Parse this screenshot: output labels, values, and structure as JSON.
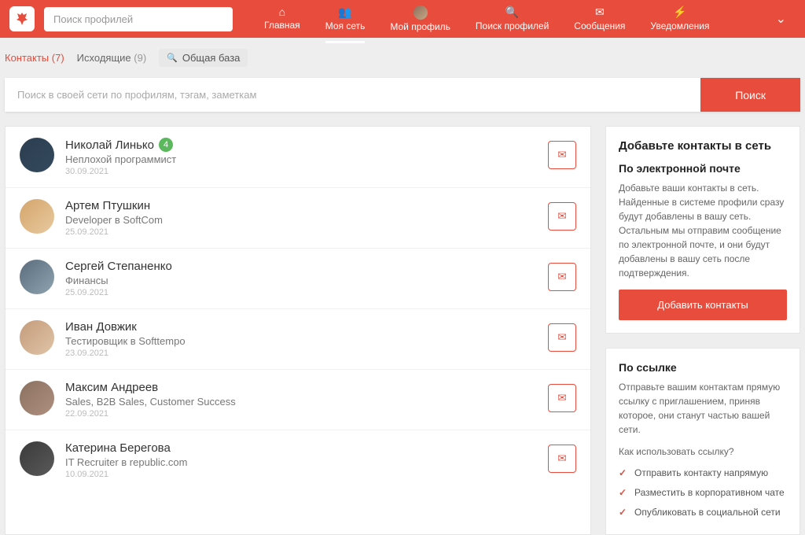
{
  "topbar": {
    "search_placeholder": "Поиск профилей",
    "nav": [
      {
        "label": "Главная"
      },
      {
        "label": "Моя сеть"
      },
      {
        "label": "Мой профиль"
      },
      {
        "label": "Поиск профилей"
      },
      {
        "label": "Сообщения"
      },
      {
        "label": "Уведомления"
      }
    ]
  },
  "tabs": {
    "contacts_label": "Контакты",
    "contacts_count": "(7)",
    "outgoing_label": "Исходящие",
    "outgoing_count": "(9)",
    "global_label": "Общая база"
  },
  "search": {
    "placeholder": "Поиск в своей сети по профилям, тэгам, заметкам",
    "button": "Поиск"
  },
  "contacts": [
    {
      "name": "Николай Линько",
      "badge": "4",
      "title": "Неплохой программист",
      "date": "30.09.2021"
    },
    {
      "name": "Артем Птушкин",
      "title": "Developer в SoftCom",
      "date": "25.09.2021"
    },
    {
      "name": "Сергей Степаненко",
      "title": "Финансы",
      "date": "25.09.2021"
    },
    {
      "name": "Иван Довжик",
      "title": "Тестировщик в Softtempo",
      "date": "23.09.2021"
    },
    {
      "name": "Максим Андреев",
      "title": "Sales, B2B Sales, Customer Success",
      "date": "22.09.2021"
    },
    {
      "name": "Катерина Берегова",
      "title": "IT Recruiter в republic.com",
      "date": "10.09.2021"
    }
  ],
  "sidebar": {
    "title": "Добавьте контакты в сеть",
    "email_heading": "По электронной почте",
    "email_text": "Добавьте ваши контакты в сеть. Найденные в системе профили сразу будут добавлены в вашу сеть. Остальным мы отправим сообщение по электронной почте, и они будут добавлены в вашу сеть после подтверждения.",
    "add_button": "Добавить контакты",
    "link_heading": "По ссылке",
    "link_text": "Отправьте вашим контактам прямую ссылку с приглашением, приняв которое, они станут частью вашей сети.",
    "link_question": "Как использовать ссылку?",
    "link_items": [
      "Отправить контакту напрямую",
      "Разместить в корпоративном чате",
      "Опубликовать в социальной сети"
    ]
  }
}
